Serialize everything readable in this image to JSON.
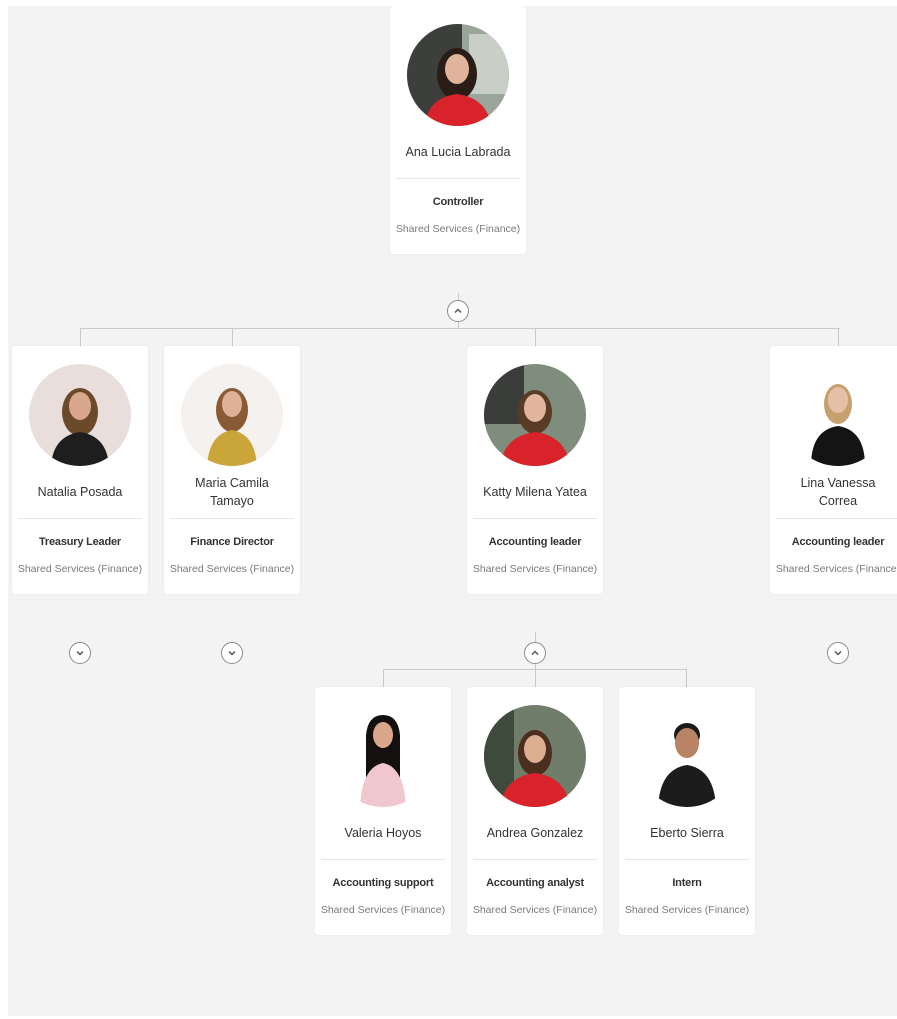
{
  "root": {
    "name": "Ana Lucia Labrada",
    "role": "Controller",
    "dept": "Shared Services (Finance)"
  },
  "level1": [
    {
      "name": "Natalia Posada",
      "role": "Treasury Leader",
      "dept": "Shared Services (Finance)"
    },
    {
      "name": "Maria Camila Tamayo",
      "role": "Finance Director",
      "dept": "Shared Services (Finance)"
    },
    {
      "name": "Katty Milena Yatea",
      "role": "Accounting leader",
      "dept": "Shared Services (Finance)"
    },
    {
      "name": "Lina Vanessa Correa",
      "role": "Accounting leader",
      "dept": "Shared Services (Finance)"
    }
  ],
  "level2": [
    {
      "name": "Valeria Hoyos",
      "role": "Accounting support",
      "dept": "Shared Services (Finance)"
    },
    {
      "name": "Andrea Gonzalez",
      "role": "Accounting analyst",
      "dept": "Shared Services (Finance)"
    },
    {
      "name": "Eberto Sierra",
      "role": "Intern",
      "dept": "Shared Services (Finance)"
    }
  ],
  "icons": {
    "collapse": "chevron-up-icon",
    "expand": "chevron-down-icon"
  },
  "colors": {
    "canvas": "#f3f3f3",
    "card": "#ffffff",
    "connector": "#c9c9c9",
    "role_text": "#333333",
    "dept_text": "#7a7a7a",
    "shirt_red": "#d8232a"
  }
}
